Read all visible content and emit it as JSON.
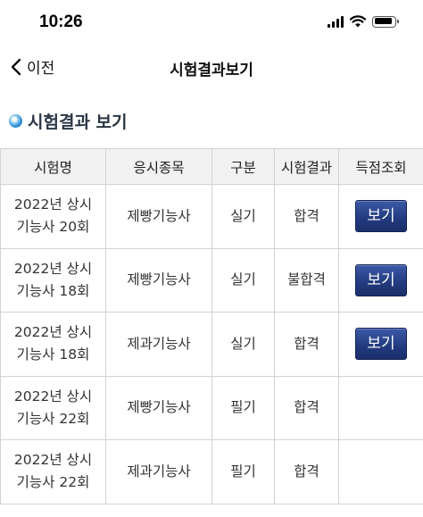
{
  "status_bar": {
    "time": "10:26"
  },
  "nav": {
    "back_label": "이전",
    "title": "시험결과보기"
  },
  "section": {
    "title": "시험결과 보기"
  },
  "table": {
    "headers": [
      "시험명",
      "응시종목",
      "구분",
      "시험결과",
      "득점조회"
    ],
    "rows": [
      {
        "exam_line1": "2022년 상시",
        "exam_line2": "기능사 20회",
        "subject": "제빵기능사",
        "category": "실기",
        "result": "합격",
        "score_button": "보기"
      },
      {
        "exam_line1": "2022년 상시",
        "exam_line2": "기능사 18회",
        "subject": "제빵기능사",
        "category": "실기",
        "result": "불합격",
        "score_button": "보기"
      },
      {
        "exam_line1": "2022년 상시",
        "exam_line2": "기능사 18회",
        "subject": "제과기능사",
        "category": "실기",
        "result": "합격",
        "score_button": "보기"
      },
      {
        "exam_line1": "2022년 상시",
        "exam_line2": "기능사 22회",
        "subject": "제빵기능사",
        "category": "필기",
        "result": "합격",
        "score_button": ""
      },
      {
        "exam_line1": "2022년 상시",
        "exam_line2": "기능사 22회",
        "subject": "제과기능사",
        "category": "필기",
        "result": "합격",
        "score_button": ""
      }
    ]
  },
  "colors": {
    "button": "#223a7d",
    "header_bg": "#f1f1f1",
    "border": "#d2d2d2",
    "section_title": "#2b3645"
  }
}
